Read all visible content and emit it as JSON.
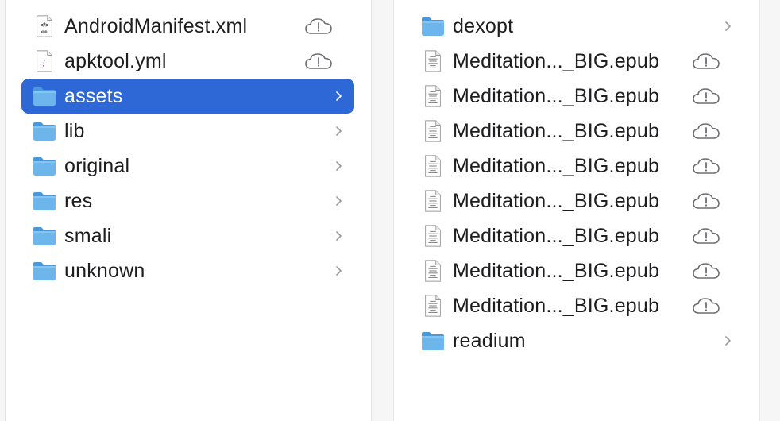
{
  "columns": [
    {
      "items": [
        {
          "name": "AndroidManifest.xml",
          "type": "xml-file",
          "icon": "xml-file-icon",
          "cloud": true,
          "chevron": false,
          "selected": false
        },
        {
          "name": "apktool.yml",
          "type": "yml-file",
          "icon": "yml-file-icon",
          "cloud": true,
          "chevron": false,
          "selected": false
        },
        {
          "name": "assets",
          "type": "folder",
          "icon": "folder-icon",
          "cloud": false,
          "chevron": true,
          "selected": true
        },
        {
          "name": "lib",
          "type": "folder",
          "icon": "folder-icon",
          "cloud": false,
          "chevron": true,
          "selected": false
        },
        {
          "name": "original",
          "type": "folder",
          "icon": "folder-icon",
          "cloud": false,
          "chevron": true,
          "selected": false
        },
        {
          "name": "res",
          "type": "folder",
          "icon": "folder-icon",
          "cloud": false,
          "chevron": true,
          "selected": false
        },
        {
          "name": "smali",
          "type": "folder",
          "icon": "folder-icon",
          "cloud": false,
          "chevron": true,
          "selected": false
        },
        {
          "name": "unknown",
          "type": "folder",
          "icon": "folder-icon",
          "cloud": false,
          "chevron": true,
          "selected": false
        }
      ]
    },
    {
      "items": [
        {
          "name": "dexopt",
          "type": "folder",
          "icon": "folder-icon",
          "cloud": false,
          "chevron": true,
          "selected": false
        },
        {
          "name": "Meditation..._BIG.epub",
          "type": "epub-file",
          "icon": "epub-file-icon",
          "cloud": true,
          "chevron": false,
          "selected": false
        },
        {
          "name": "Meditation..._BIG.epub",
          "type": "epub-file",
          "icon": "epub-file-icon",
          "cloud": true,
          "chevron": false,
          "selected": false
        },
        {
          "name": "Meditation..._BIG.epub",
          "type": "epub-file",
          "icon": "epub-file-icon",
          "cloud": true,
          "chevron": false,
          "selected": false
        },
        {
          "name": "Meditation..._BIG.epub",
          "type": "epub-file",
          "icon": "epub-file-icon",
          "cloud": true,
          "chevron": false,
          "selected": false
        },
        {
          "name": "Meditation..._BIG.epub",
          "type": "epub-file",
          "icon": "epub-file-icon",
          "cloud": true,
          "chevron": false,
          "selected": false
        },
        {
          "name": "Meditation..._BIG.epub",
          "type": "epub-file",
          "icon": "epub-file-icon",
          "cloud": true,
          "chevron": false,
          "selected": false
        },
        {
          "name": "Meditation..._BIG.epub",
          "type": "epub-file",
          "icon": "epub-file-icon",
          "cloud": true,
          "chevron": false,
          "selected": false
        },
        {
          "name": "Meditation..._BIG.epub",
          "type": "epub-file",
          "icon": "epub-file-icon",
          "cloud": true,
          "chevron": false,
          "selected": false
        },
        {
          "name": "readium",
          "type": "folder",
          "icon": "folder-icon",
          "cloud": false,
          "chevron": true,
          "selected": false
        }
      ]
    }
  ],
  "xml_icon_text": {
    "glyph": "</>",
    "label": "XML"
  },
  "yml_icon_text": "!",
  "colors": {
    "selection": "#2e67d6",
    "folder": "#6cb6ec",
    "folder_dark": "#4a98d8",
    "cloud_stroke": "#6e6e73",
    "chevron": "#9a9a9a",
    "chevron_selected": "#ffffff"
  }
}
